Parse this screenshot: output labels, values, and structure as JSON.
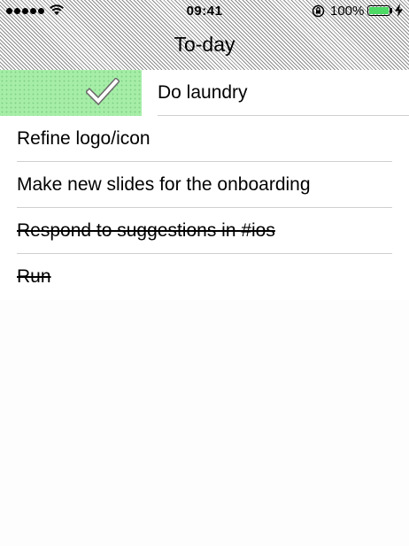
{
  "status_bar": {
    "time": "09:41",
    "battery_percent": "100%",
    "battery_level": 1.0,
    "signal_bars": 5,
    "icons": [
      "signal-icon",
      "wifi-icon",
      "rotation-lock-icon",
      "battery-icon",
      "charging-bolt-icon"
    ]
  },
  "nav": {
    "title": "To-day"
  },
  "colors": {
    "swipe_accent": "#a6eea8",
    "battery_fill": "#4cd964"
  },
  "tasks": [
    {
      "label": "Do laundry",
      "completed": false,
      "swiped": true
    },
    {
      "label": "Refine logo/icon",
      "completed": false,
      "swiped": false
    },
    {
      "label": "Make new slides for the onboarding",
      "completed": false,
      "swiped": false
    },
    {
      "label": "Respond to suggestions in #ios",
      "completed": true,
      "swiped": false
    },
    {
      "label": "Run",
      "completed": true,
      "swiped": false
    }
  ]
}
